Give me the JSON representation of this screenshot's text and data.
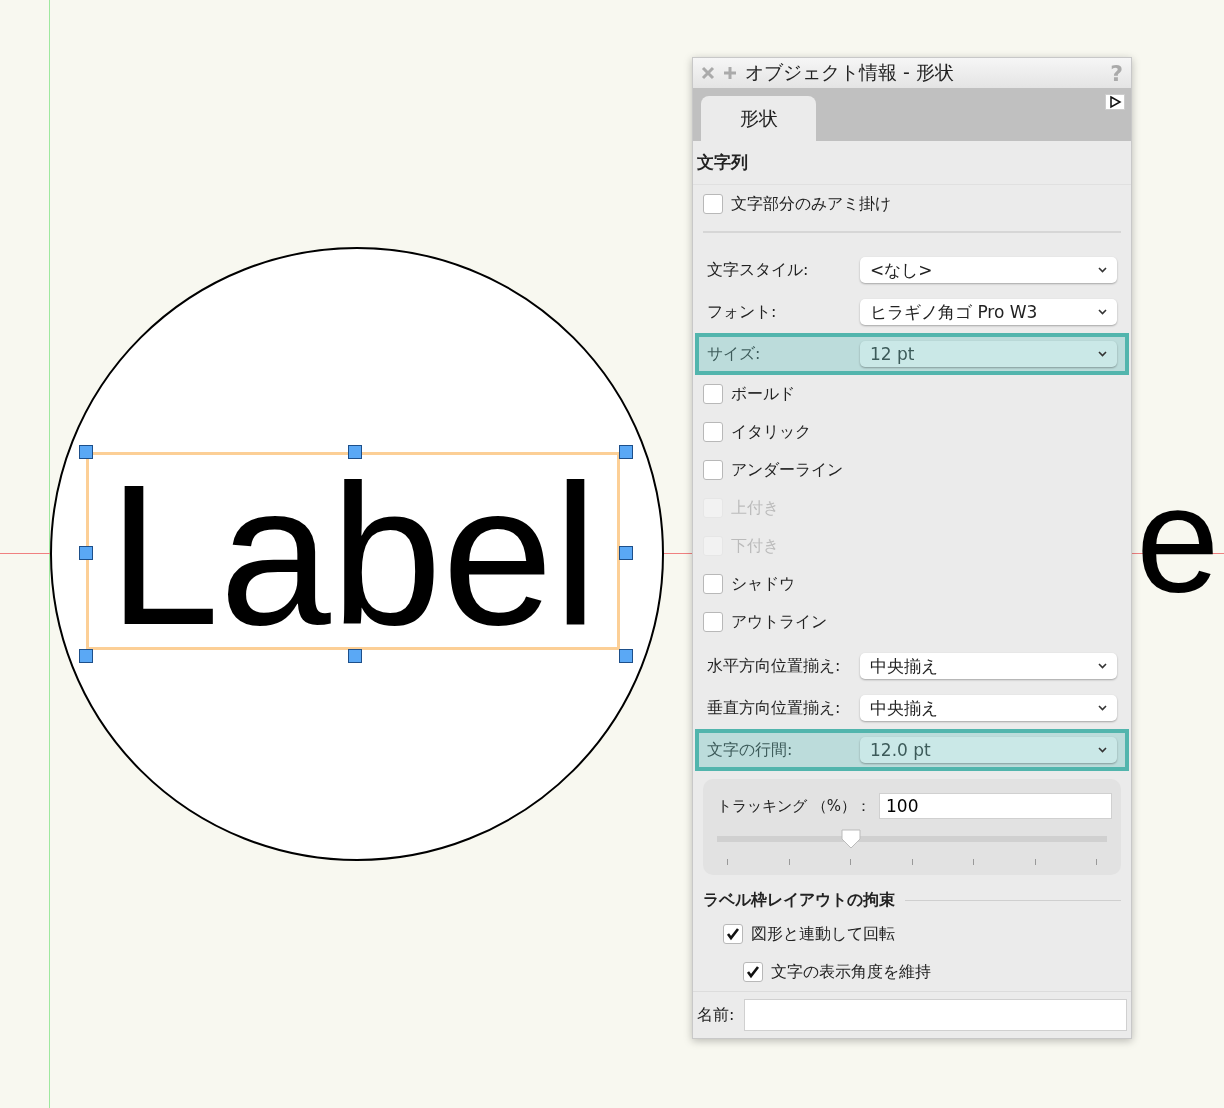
{
  "canvas": {
    "label_text": "Label",
    "partial_text": "e"
  },
  "panel": {
    "title": "オブジェクト情報 - 形状",
    "help": "?",
    "tabs": [
      {
        "label": "形状",
        "selected": true
      }
    ],
    "section": "文字列",
    "top_options": [
      {
        "label": "文字部分のみアミ掛け",
        "checked": false,
        "disabled": false
      }
    ],
    "fields_1": [
      {
        "label": "文字スタイル:",
        "value": "<なし>",
        "highlighted": false
      },
      {
        "label": "フォント:",
        "value": "ヒラギノ角ゴ Pro W3",
        "highlighted": false
      },
      {
        "label": "サイズ:",
        "value": "12 pt",
        "highlighted": true
      }
    ],
    "styles": [
      {
        "label": "ボールド",
        "checked": false,
        "disabled": false
      },
      {
        "label": "イタリック",
        "checked": false,
        "disabled": false
      },
      {
        "label": "アンダーライン",
        "checked": false,
        "disabled": false
      },
      {
        "label": "上付き",
        "checked": false,
        "disabled": true
      },
      {
        "label": "下付き",
        "checked": false,
        "disabled": true
      },
      {
        "label": "シャドウ",
        "checked": false,
        "disabled": false
      },
      {
        "label": "アウトライン",
        "checked": false,
        "disabled": false
      }
    ],
    "fields_2": [
      {
        "label": "水平方向位置揃え:",
        "value": "中央揃え",
        "highlighted": false
      },
      {
        "label": "垂直方向位置揃え:",
        "value": "中央揃え",
        "highlighted": false
      },
      {
        "label": "文字の行間:",
        "value": "12.0 pt",
        "highlighted": true
      }
    ],
    "tracking": {
      "label": "トラッキング （%）：",
      "value": "100",
      "level": 0.343
    },
    "constraints": {
      "title": "ラベル枠レイアウトの拘束",
      "items": [
        {
          "label": "図形と連動して回転",
          "checked": true,
          "children": [
            {
              "label": "文字の表示角度を維持",
              "checked": true
            }
          ]
        }
      ]
    },
    "name_field": {
      "label": "名前:"
    }
  }
}
